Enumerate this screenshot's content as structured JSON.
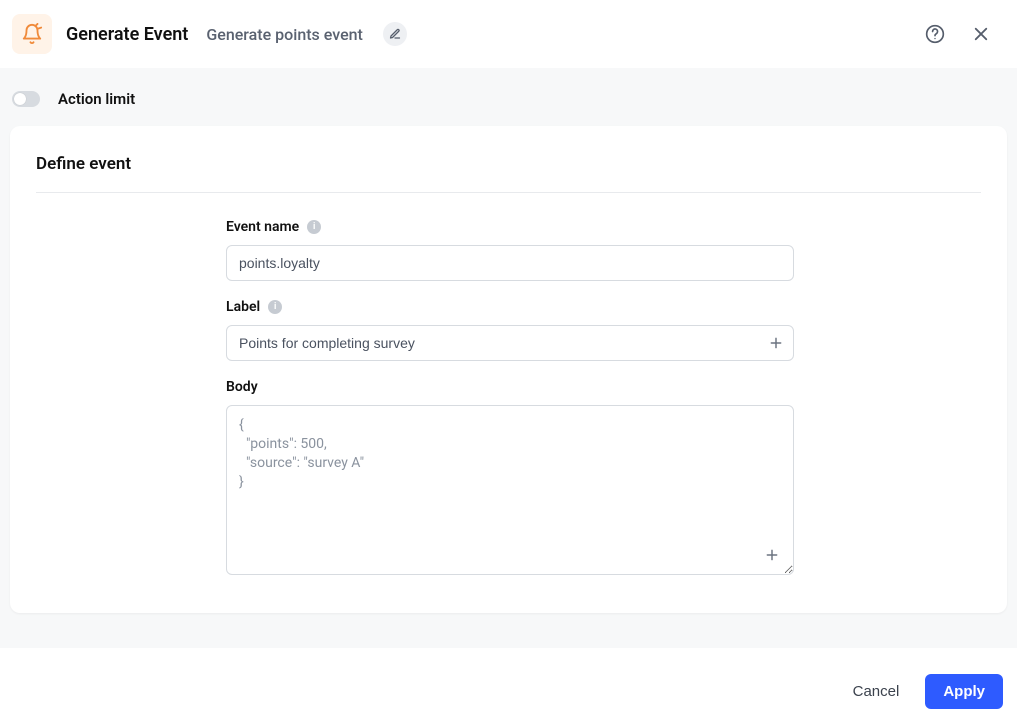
{
  "header": {
    "title": "Generate Event",
    "subtitle": "Generate points event"
  },
  "action_limit": {
    "label": "Action limit",
    "enabled": false
  },
  "card": {
    "title": "Define event"
  },
  "fields": {
    "event_name": {
      "label": "Event name",
      "value": "points.loyalty"
    },
    "label_field": {
      "label": "Label",
      "value": "Points for completing survey"
    },
    "body": {
      "label": "Body",
      "value": "{\n  \"points\": 500,\n  \"source\": \"survey A\"\n}"
    }
  },
  "footer": {
    "cancel": "Cancel",
    "apply": "Apply"
  },
  "icons": {
    "hint_glyph": "i"
  }
}
